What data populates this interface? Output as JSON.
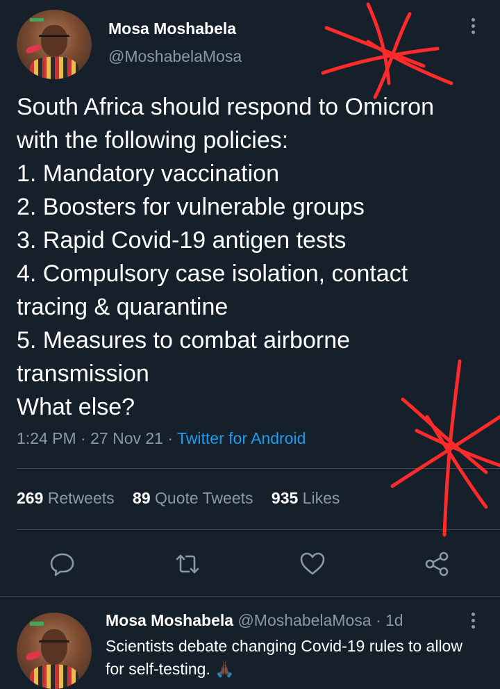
{
  "tweet": {
    "author_name": "Mosa Moshabela",
    "author_handle": "@MoshabelaMosa",
    "text_lines": [
      "South Africa should respond to Omicron",
      "with the following policies:",
      "1. Mandatory vaccination",
      "2. Boosters for vulnerable groups",
      "3. Rapid Covid-19 antigen tests",
      "4. Compulsory case isolation, contact",
      "tracing & quarantine",
      "5. Measures to combat airborne",
      "transmission",
      "What else?"
    ],
    "time": "1:24 PM",
    "date": "27 Nov 21",
    "sep": "·",
    "source": "Twitter for Android"
  },
  "stats": {
    "retweets_count": "269",
    "retweets_label": "Retweets",
    "quotes_count": "89",
    "quotes_label": "Quote Tweets",
    "likes_count": "935",
    "likes_label": "Likes"
  },
  "actions": [
    "reply-icon",
    "retweet-icon",
    "like-icon",
    "share-icon"
  ],
  "reply": {
    "author_name": "Mosa Moshabela",
    "author_handle": "@MoshabelaMosa",
    "age": "· 1d",
    "text": "Scientists debate changing Covid-19 rules to allow for self-testing. 🙏🏿"
  },
  "colors": {
    "background": "#15202b",
    "secondary_text": "#8b98a5",
    "link": "#1d9bf0",
    "divider": "#38444d",
    "annotation_red": "#ff2a2a"
  }
}
